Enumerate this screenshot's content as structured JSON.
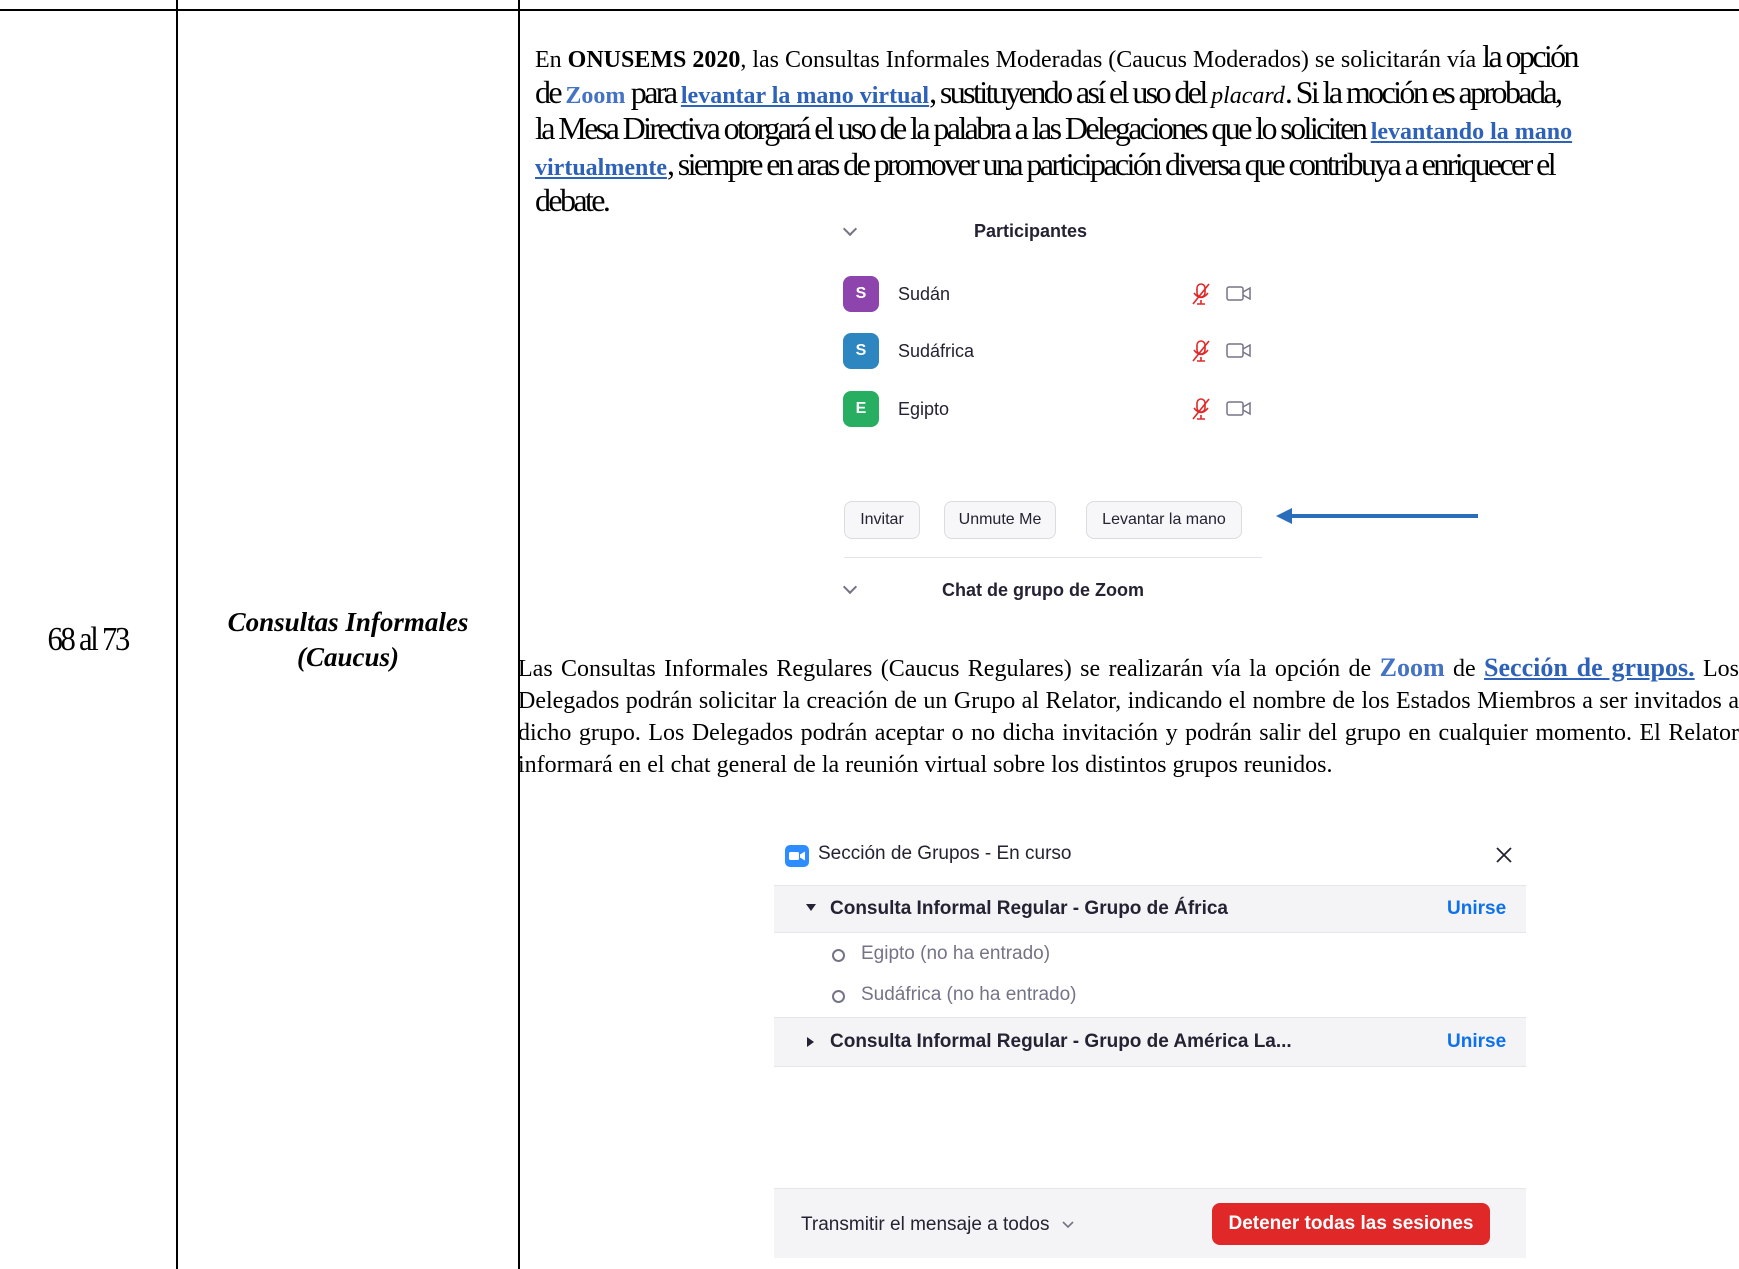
{
  "row": {
    "articles": "68 al 73",
    "topic_line1": "Consultas Informales",
    "topic_line2": "(Caucus)"
  },
  "para1": {
    "s1": "En ",
    "s2": "ONUSEMS 2020",
    "s3": ", las Consultas Informales Moderadas (Caucus Moderados) se solicitarán vía ",
    "s4": "la opción",
    "s5": "de ",
    "s6": "Zoom",
    "s7": " para ",
    "s8": "levantar la mano virtual",
    "s9": ", sustituyendo así el uso del ",
    "s10": "placard",
    "s11": ". Si la moción es aprobada,",
    "s12": "la Mesa Directiva otorgará el uso de la palabra a las Delegaciones que lo soliciten ",
    "s13": "levantando la mano",
    "s14": "virtualmente",
    "s15": ", siempre en aras de promover una participación diversa que contribuya a enriquecer el",
    "s16": "debate."
  },
  "participants_panel": {
    "title": "Participantes",
    "participants": [
      {
        "initial": "S",
        "name": "Sudán",
        "color": "#8e44ad"
      },
      {
        "initial": "S",
        "name": "Sudáfrica",
        "color": "#2e86c1"
      },
      {
        "initial": "E",
        "name": "Egipto",
        "color": "#27ae60"
      }
    ],
    "buttons": [
      "Invitar",
      "Unmute Me",
      "Levantar la mano"
    ],
    "chat_title": "Chat de grupo de Zoom",
    "arrow_color": "#2a6ebb",
    "mic_off_color": "#e02828"
  },
  "para2": {
    "s1": "Las Consultas Informales Regulares (Caucus Regulares) se realizarán vía la opción de ",
    "s2": "Zoom",
    "s3": " de ",
    "s4": "Sección de grupos.",
    "s5": " Los Delegados podrán solicitar la creación de un Grupo al Relator, indicando el nombre de los Estados Miembros a ser invitados a dicho grupo. Los Delegados podrán aceptar o no dicha invitación y podrán salir del grupo en cualquier momento. El Relator informará en el chat general de la reunión virtual sobre los distintos grupos reunidos."
  },
  "breakout_panel": {
    "title": "Sección de Grupos - En curso",
    "groups": [
      {
        "name": "Consulta Informal Regular - Grupo de África",
        "join": "Unirse",
        "expanded": true,
        "members": [
          "Egipto (no ha entrado)",
          "Sudáfrica (no ha entrado)"
        ]
      },
      {
        "name": "Consulta Informal Regular - Grupo de América La...",
        "join": "Unirse",
        "expanded": false,
        "members": []
      }
    ],
    "broadcast": "Transmitir el mensaje a todos",
    "stop_button": "Detener todas las sesiones",
    "stop_color": "#e02828",
    "join_color": "#0e71eb"
  }
}
